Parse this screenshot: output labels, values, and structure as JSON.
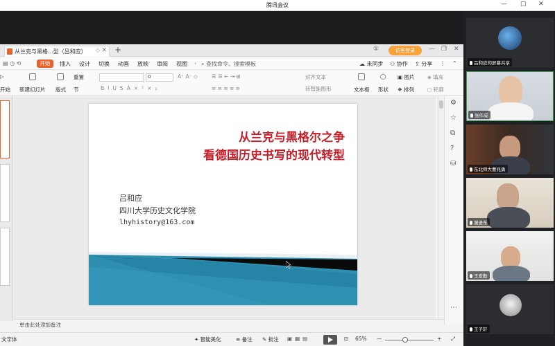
{
  "window": {
    "title": "腾讯会议"
  },
  "wps": {
    "tab_title": "从兰克与黑格...型（吕和应）",
    "visitor_login": "访客登录",
    "menu": [
      "开始",
      "插入",
      "设计",
      "切换",
      "动画",
      "放映",
      "审阅",
      "视图"
    ],
    "search_placeholder": "查找命令、搜索模板",
    "right_menu": {
      "sync": "未同步",
      "collab": "协作",
      "share": "分享"
    },
    "ribbon": {
      "new_slide": "新建幻灯片",
      "layout": "版式",
      "section": "节",
      "reset": "重置",
      "from_start": "开始",
      "font_size": "0",
      "align_text": "对齐文本",
      "smartart": "转智能图形",
      "textbox": "文本框",
      "shape": "形状",
      "picture": "图片",
      "arrange": "排列",
      "fill": "填充",
      "outline": "轮廓"
    },
    "notes_placeholder": "单击此处添加备注",
    "status": {
      "font": "文字体",
      "beautify": "智能美化",
      "notes": "备注",
      "comments": "批注",
      "zoom": "65%"
    }
  },
  "slide": {
    "title_line1": "从兰克与黑格尔之争",
    "title_line2": "看德国历史书写的现代转型",
    "author": "吕和应",
    "affiliation": "四川大学历史文化学院",
    "email": "lhyhistory@163.com",
    "colors": {
      "title": "#c8202a",
      "wave": "#2f8fb1",
      "band": "#0a0a0a"
    }
  },
  "participants": [
    {
      "name": "吕和应的屏幕共享"
    },
    {
      "name": "张作成"
    },
    {
      "name": "东北师大曹兆勇"
    },
    {
      "name": "谢进东"
    },
    {
      "name": "王爱勤"
    },
    {
      "name": "王子轩"
    }
  ]
}
